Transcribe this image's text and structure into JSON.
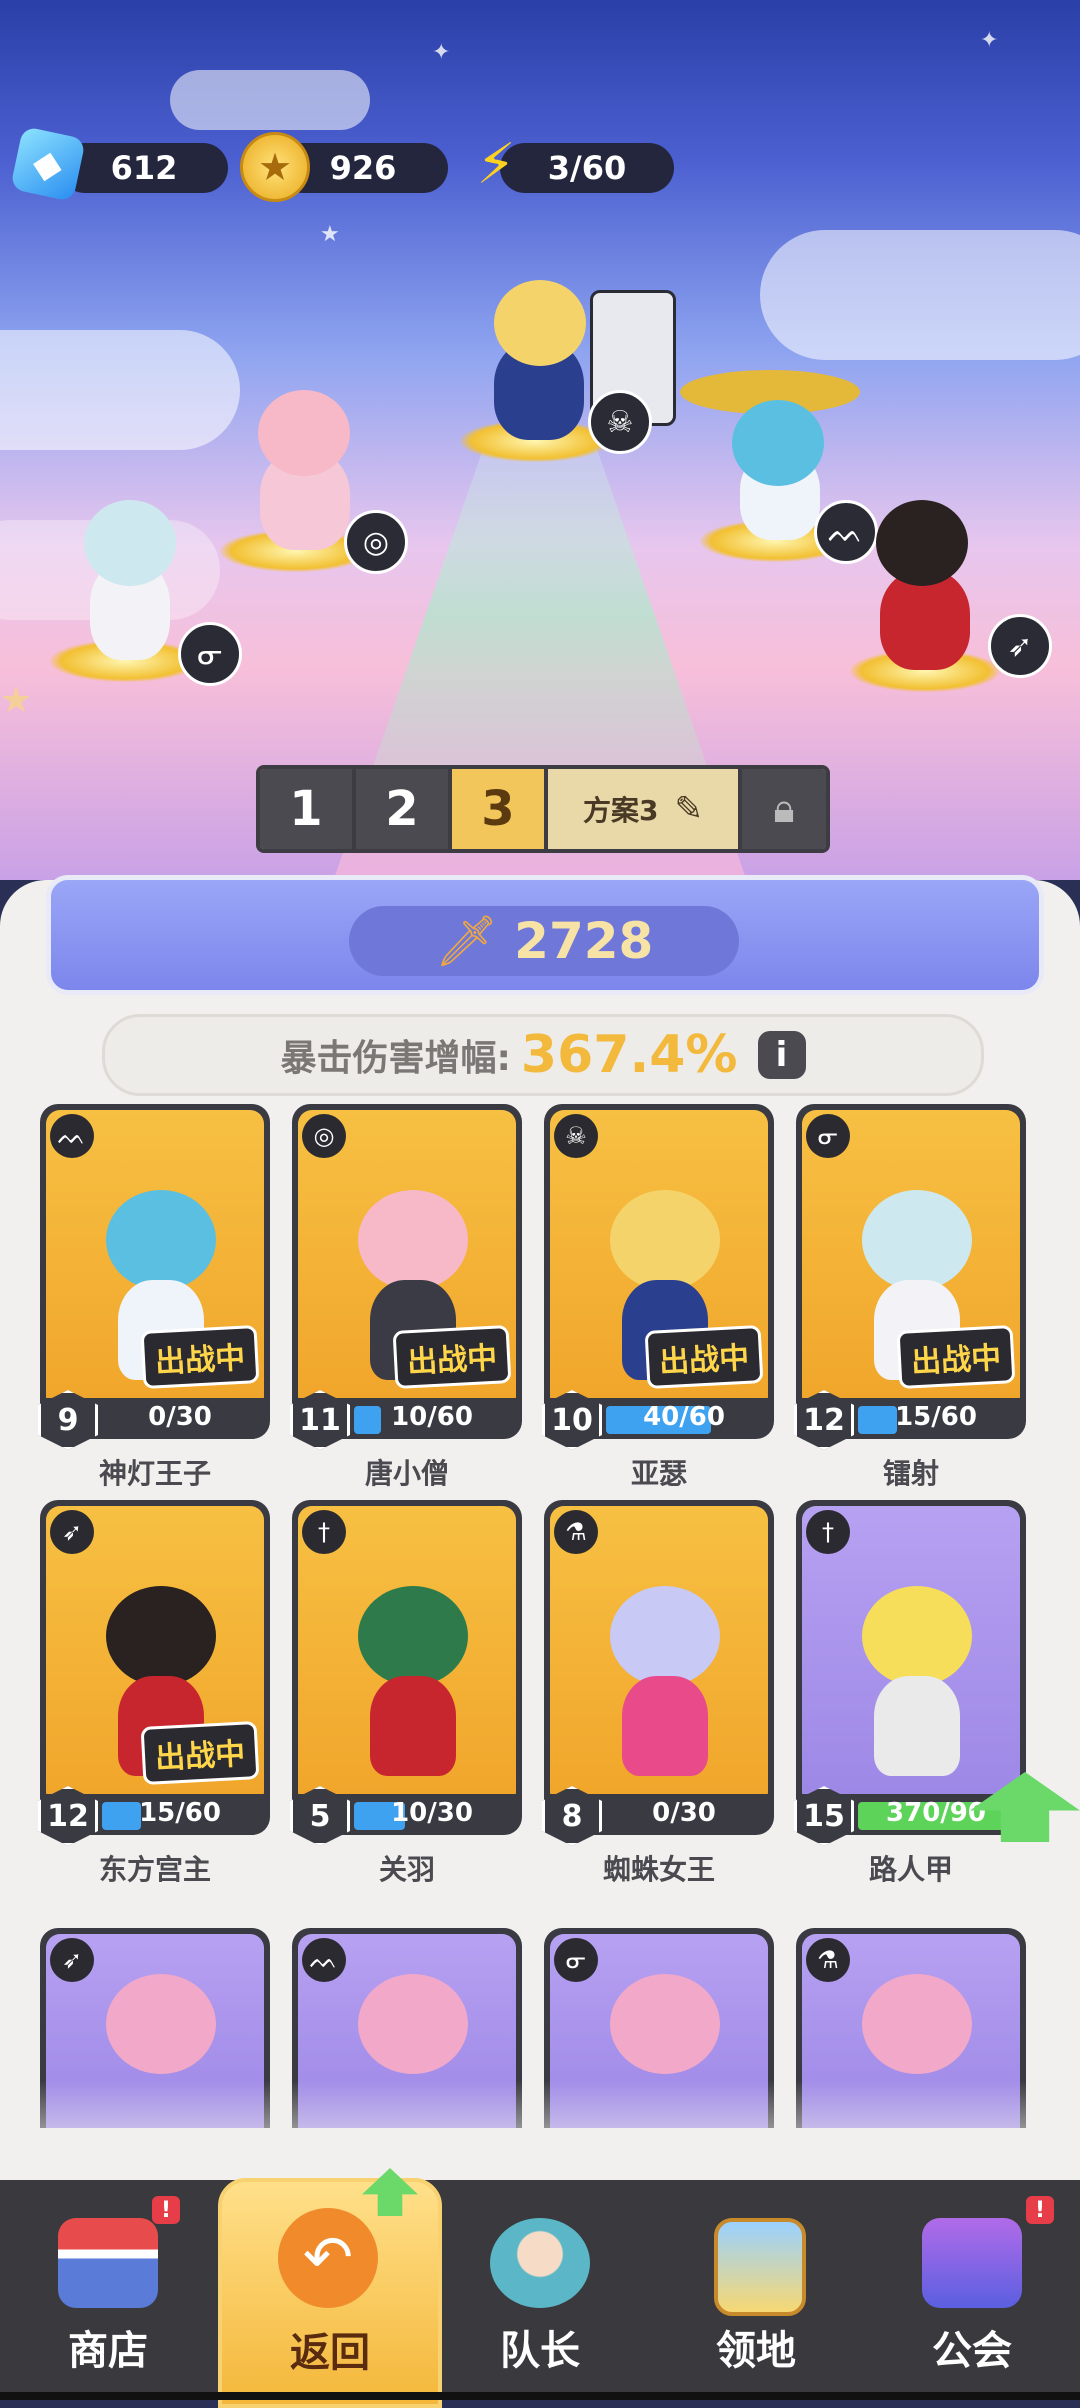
{
  "resources": {
    "gems": "612",
    "coins": "926",
    "energy": "3/60"
  },
  "lineup": {
    "slots": [
      "1",
      "2",
      "3"
    ],
    "active_slot": "3",
    "plan_label": "方案3"
  },
  "power": "2728",
  "crit": {
    "label": "暴击伤害增幅:",
    "value": "367.4%",
    "info_label": "i"
  },
  "heroes": [
    {
      "name": "神灯王子",
      "level": "9",
      "progress": "0/30",
      "fill": 0.0,
      "deployed": true,
      "deployed_label": "出战中",
      "color": "gold",
      "class_icon": "wings-icon"
    },
    {
      "name": "唐小僧",
      "level": "11",
      "progress": "10/60",
      "fill": 0.17,
      "deployed": true,
      "deployed_label": "出战中",
      "color": "gold",
      "class_icon": "spiral-icon"
    },
    {
      "name": "亚瑟",
      "level": "10",
      "progress": "40/60",
      "fill": 0.67,
      "deployed": true,
      "deployed_label": "出战中",
      "color": "gold",
      "class_icon": "skull-icon"
    },
    {
      "name": "镭射",
      "level": "12",
      "progress": "15/60",
      "fill": 0.25,
      "deployed": true,
      "deployed_label": "出战中",
      "color": "gold",
      "class_icon": "staff-icon"
    },
    {
      "name": "东方宫主",
      "level": "12",
      "progress": "15/60",
      "fill": 0.25,
      "deployed": true,
      "deployed_label": "出战中",
      "color": "gold",
      "class_icon": "bow-icon"
    },
    {
      "name": "关羽",
      "level": "5",
      "progress": "10/30",
      "fill": 0.33,
      "deployed": false,
      "color": "gold",
      "class_icon": "sword-icon"
    },
    {
      "name": "蜘蛛女王",
      "level": "8",
      "progress": "0/30",
      "fill": 0.0,
      "deployed": false,
      "color": "gold",
      "class_icon": "potion-icon"
    },
    {
      "name": "路人甲",
      "level": "15",
      "progress": "370/90",
      "fill": 1.0,
      "deployed": false,
      "color": "purple",
      "class_icon": "sword-icon",
      "upgradable": true
    }
  ],
  "heroes_partial": [
    {
      "color": "purple",
      "class_icon": "bow-icon"
    },
    {
      "color": "purple",
      "class_icon": "wings-icon"
    },
    {
      "color": "purple",
      "class_icon": "staff-icon"
    },
    {
      "color": "purple",
      "class_icon": "potion-icon"
    }
  ],
  "nav": [
    {
      "label": "商店",
      "badge": "!"
    },
    {
      "label": "返回",
      "active": true
    },
    {
      "label": "队长"
    },
    {
      "label": "领地"
    },
    {
      "label": "公会",
      "badge": "!"
    }
  ],
  "colors": {
    "accent_gold": "#f2b93c",
    "power_blue": "#7c86ec",
    "progress_blue": "#3fa2f0",
    "progress_green": "#5dd35a",
    "badge_red": "#e63d48"
  }
}
